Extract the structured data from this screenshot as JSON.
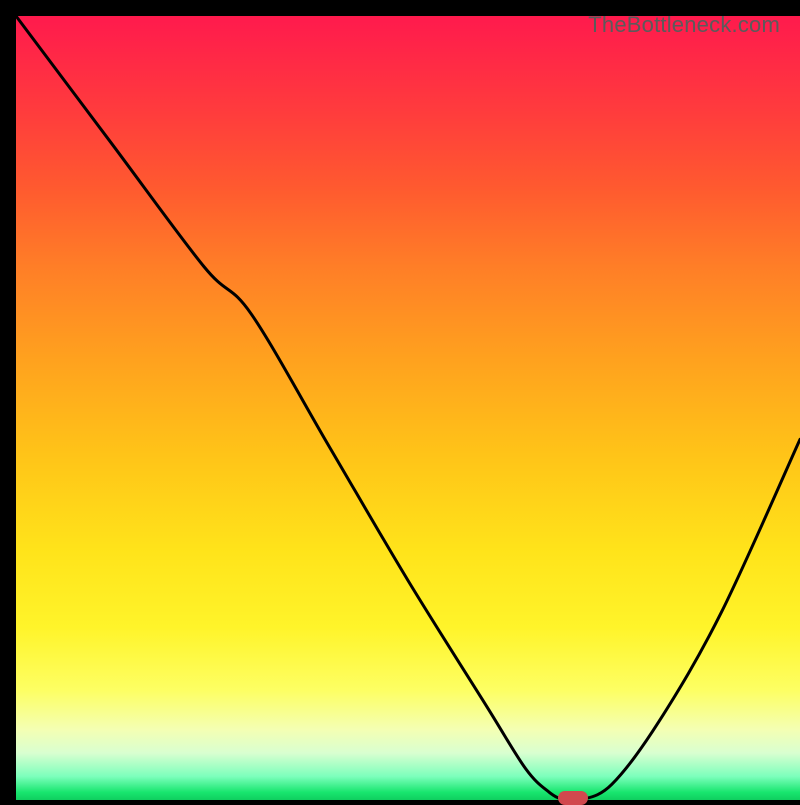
{
  "watermark": "TheBottleneck.com",
  "colors": {
    "frame": "#000000",
    "curve": "#000000",
    "marker": "#d1484e",
    "gradient_top": "#ff1a4d",
    "gradient_bottom": "#0fce5f"
  },
  "chart_data": {
    "type": "line",
    "title": "",
    "xlabel": "",
    "ylabel": "",
    "xlim": [
      0,
      100
    ],
    "ylim": [
      0,
      100
    ],
    "series": [
      {
        "name": "bottleneck-curve",
        "x": [
          0,
          12,
          24,
          30,
          40,
          50,
          60,
          65,
          68,
          70,
          72,
          76,
          82,
          90,
          100
        ],
        "values": [
          100,
          84,
          68,
          62,
          45,
          28,
          12,
          4,
          1,
          0,
          0,
          2,
          10,
          24,
          46
        ]
      }
    ],
    "annotations": [
      {
        "type": "marker",
        "shape": "pill",
        "x": 71,
        "y": 0,
        "color": "#d1484e"
      }
    ],
    "background": {
      "type": "vertical-gradient",
      "meaning": "red=high bottleneck, green=low bottleneck"
    }
  }
}
